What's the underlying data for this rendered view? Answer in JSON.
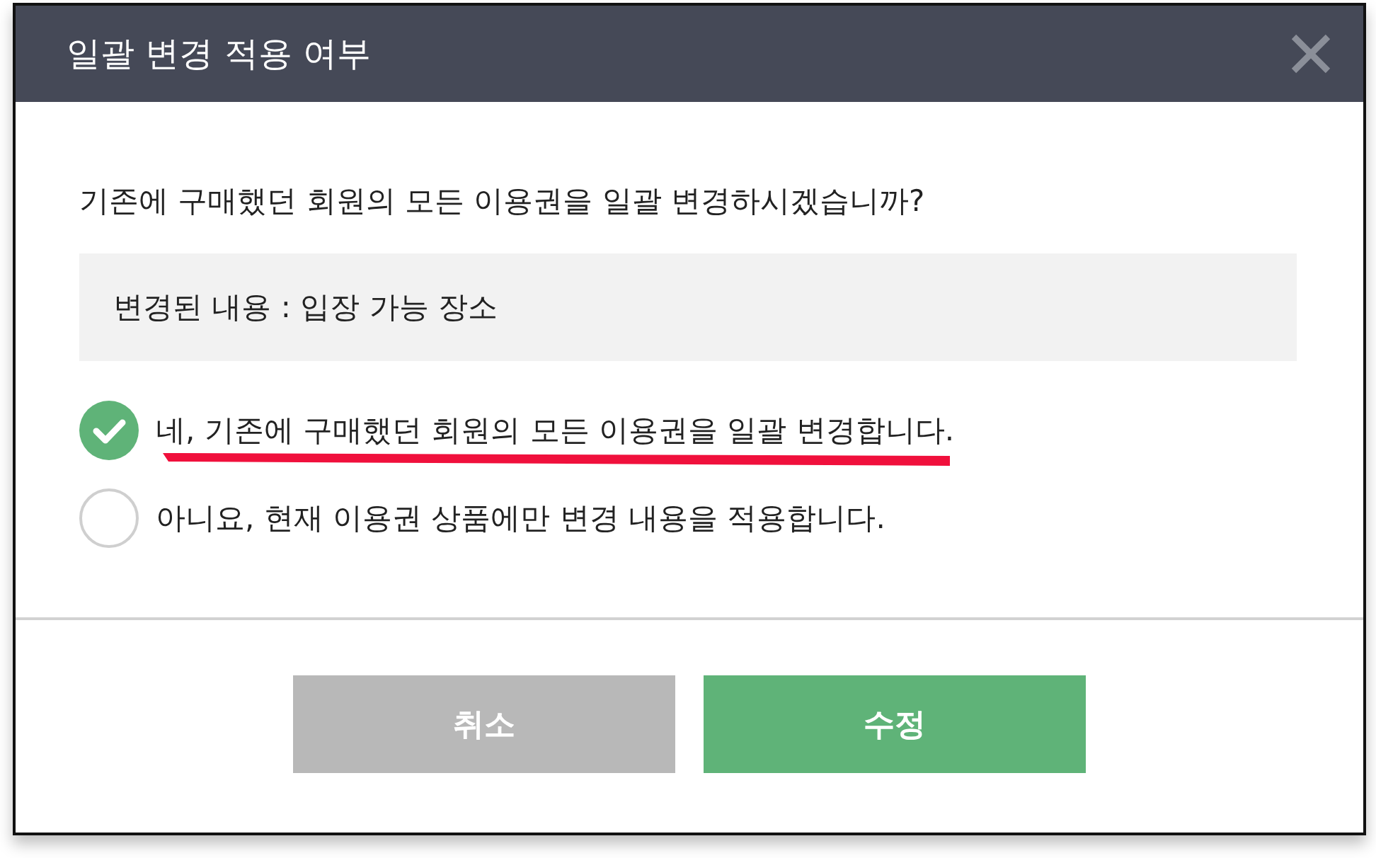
{
  "dialog": {
    "title": "일괄 변경 적용 여부",
    "question": "기존에 구매했던 회원의 모든 이용권을 일괄 변경하시겠습니까?",
    "change_summary": "변경된 내용 : 입장 가능 장소",
    "options": [
      {
        "label": "네, 기존에 구매했던 회원의 모든 이용권을 일괄 변경합니다.",
        "selected": true
      },
      {
        "label": "아니요, 현재 이용권 상품에만 변경 내용을 적용합니다.",
        "selected": false
      }
    ],
    "buttons": [
      {
        "label": "취소",
        "kind": "cancel"
      },
      {
        "label": "수정",
        "kind": "primary"
      }
    ]
  }
}
